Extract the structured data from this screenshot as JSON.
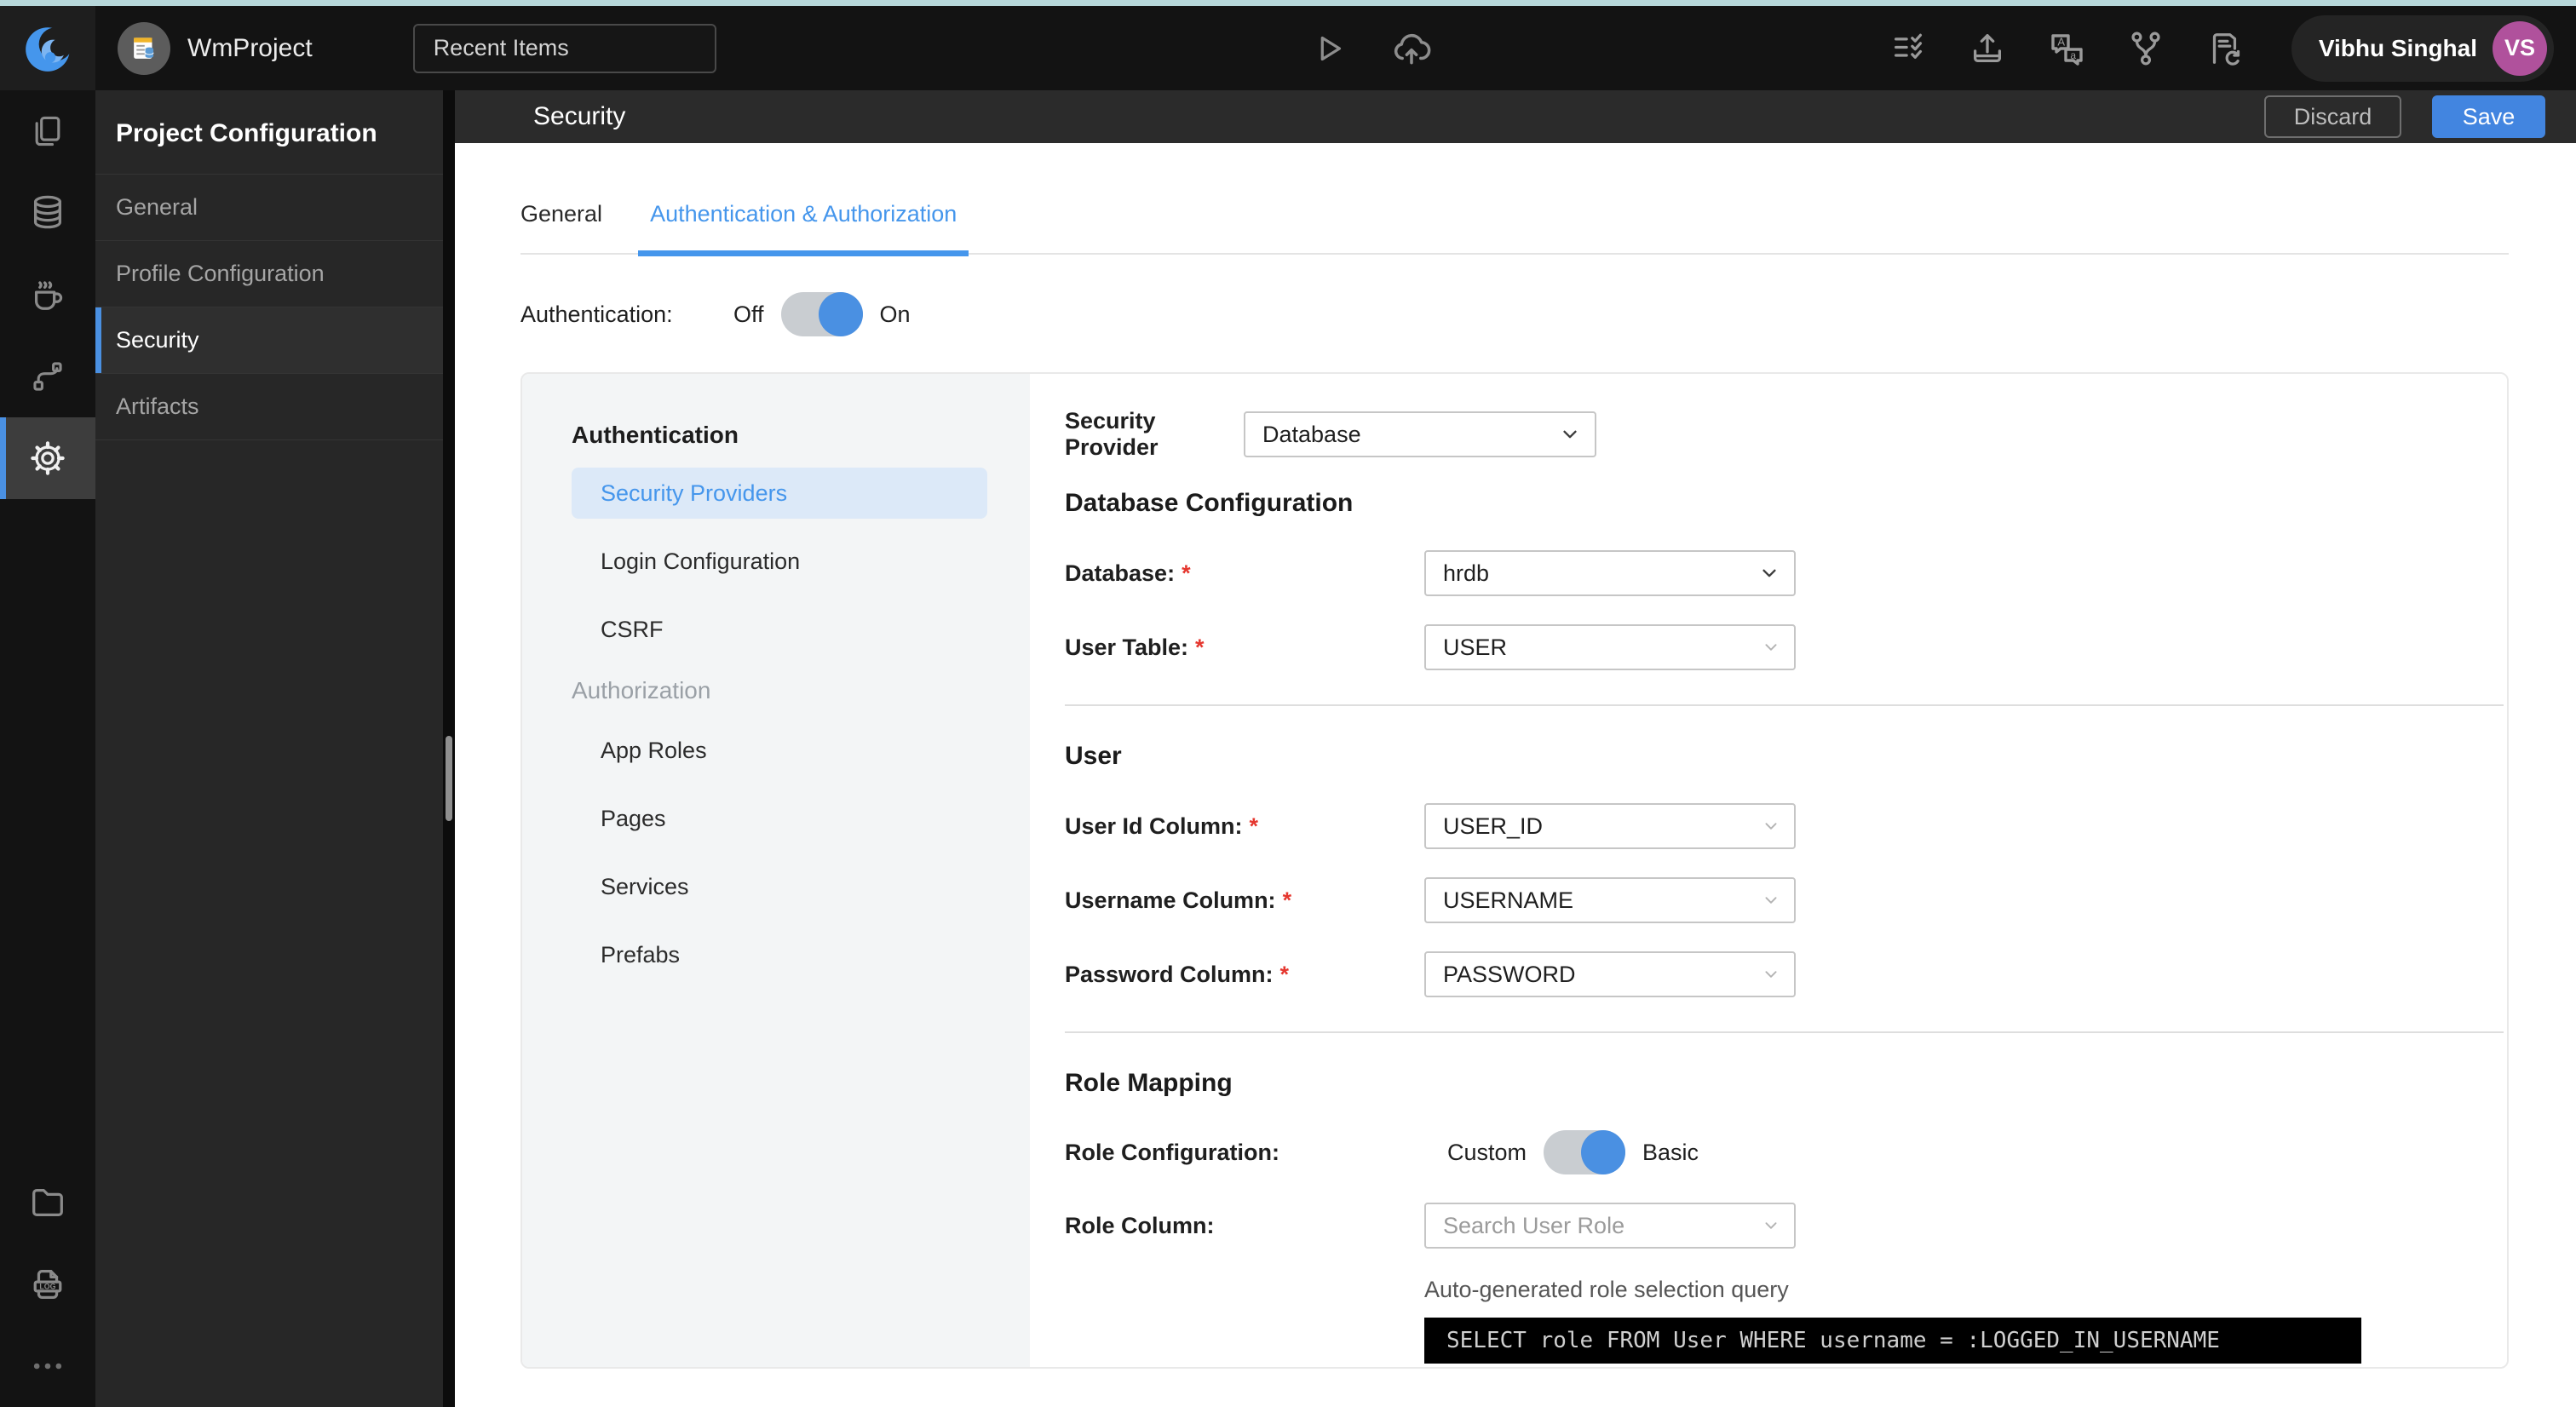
{
  "colors": {
    "accent": "#4596ec",
    "save_button": "#4285e0",
    "toggle_knob": "#4a90e2",
    "avatar": "#b0519c",
    "topline": "#b7d7da"
  },
  "icons": [
    "wavemaker-logo",
    "project-avatar",
    "play-icon",
    "deploy-cloud-icon",
    "checklist-icon",
    "export-icon",
    "translate-icon",
    "git-branch-icon",
    "file-sync-icon",
    "pages-icon",
    "database-icon",
    "java-services-icon",
    "orchestration-icon",
    "settings-icon",
    "folder-icon",
    "logs-icon",
    "more-icon",
    "chevron-down-icon"
  ],
  "topbar": {
    "project_name": "WmProject",
    "recent_items_label": "Recent Items",
    "user_name": "Vibhu Singhal",
    "user_initials": "VS"
  },
  "sidebar": {
    "title": "Project Configuration",
    "items": [
      {
        "label": "General"
      },
      {
        "label": "Profile Configuration"
      },
      {
        "label": "Security"
      },
      {
        "label": "Artifacts"
      }
    ]
  },
  "header": {
    "title": "Security",
    "discard_label": "Discard",
    "save_label": "Save"
  },
  "tabs": [
    {
      "label": "General"
    },
    {
      "label": "Authentication & Authorization"
    }
  ],
  "auth": {
    "label": "Authentication:",
    "off_label": "Off",
    "on_label": "On",
    "state": "on"
  },
  "nav": {
    "sections": [
      {
        "title": "Authentication",
        "items": [
          {
            "label": "Security Providers"
          },
          {
            "label": "Login Configuration"
          },
          {
            "label": "CSRF"
          }
        ]
      },
      {
        "title": "Authorization",
        "items": [
          {
            "label": "App Roles"
          },
          {
            "label": "Pages"
          },
          {
            "label": "Services"
          },
          {
            "label": "Prefabs"
          }
        ]
      }
    ]
  },
  "form": {
    "required_marker": "*",
    "provider": {
      "label": "Security Provider",
      "value": "Database"
    },
    "db_section": {
      "title": "Database Configuration",
      "database": {
        "label": "Database:",
        "value": "hrdb"
      },
      "user_table": {
        "label": "User Table:",
        "value": "USER"
      }
    },
    "user_section": {
      "title": "User",
      "user_id": {
        "label": "User Id Column:",
        "value": "USER_ID"
      },
      "username": {
        "label": "Username Column:",
        "value": "USERNAME"
      },
      "password": {
        "label": "Password Column:",
        "value": "PASSWORD"
      }
    },
    "role_section": {
      "title": "Role Mapping",
      "role_config": {
        "label": "Role Configuration:",
        "custom_label": "Custom",
        "basic_label": "Basic",
        "state": "basic"
      },
      "role_column": {
        "label": "Role Column:",
        "placeholder": "Search User Role"
      },
      "query_caption": "Auto-generated role selection query",
      "query": "SELECT role FROM User WHERE username = :LOGGED_IN_USERNAME"
    }
  }
}
